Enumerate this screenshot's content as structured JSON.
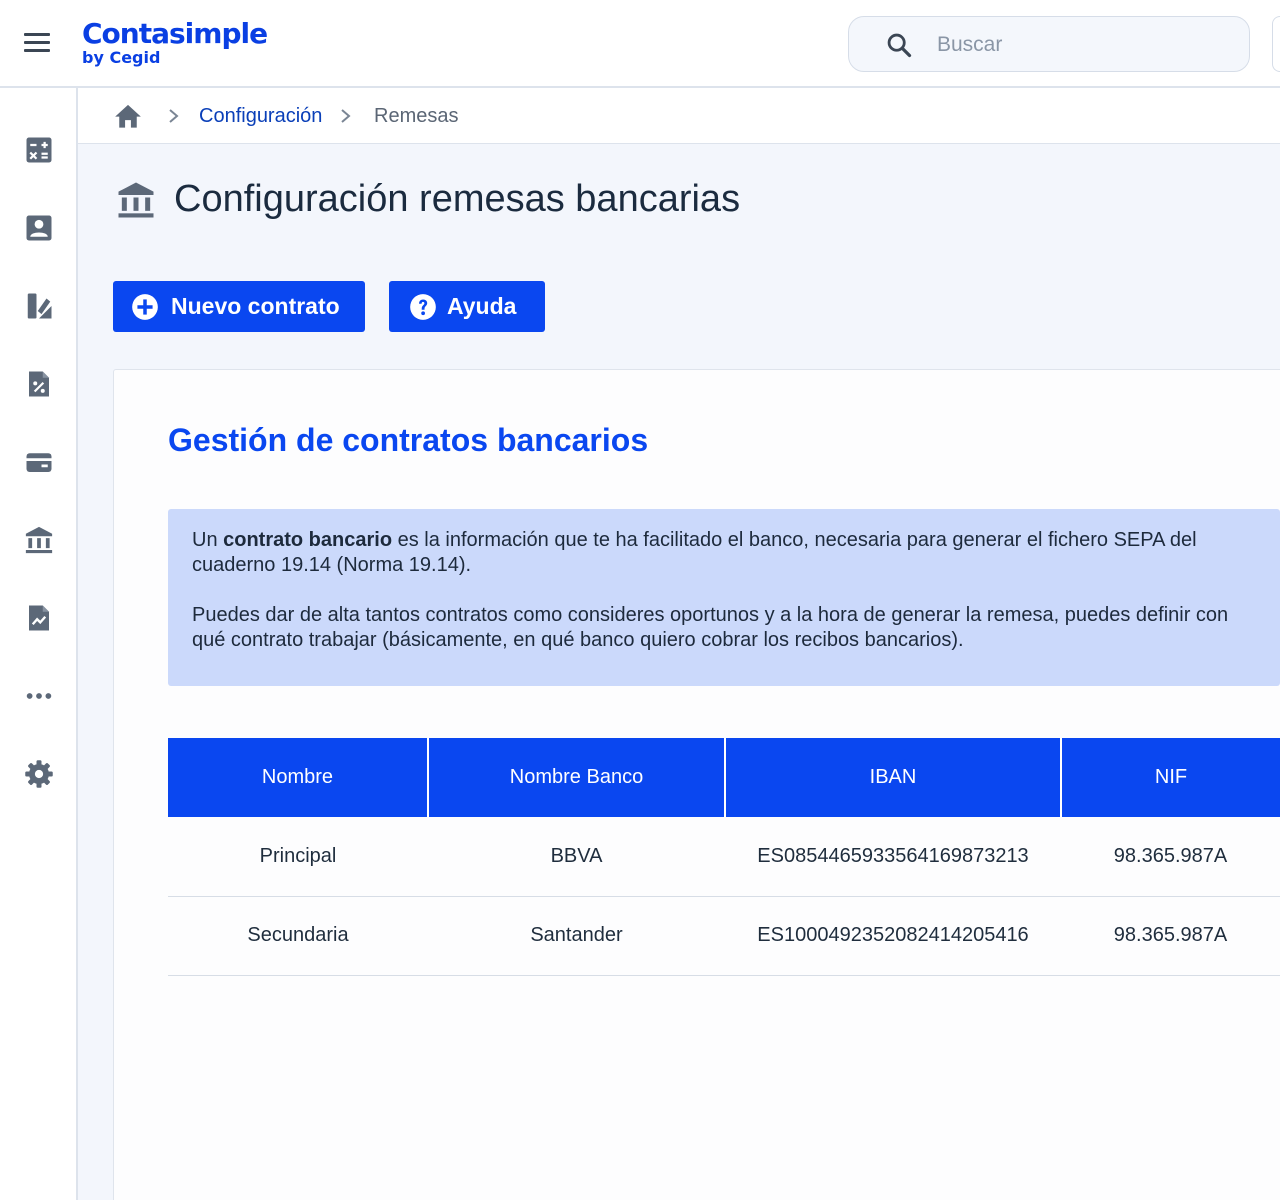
{
  "header": {
    "brand_name": "Contasimple",
    "brand_sub": "by Cegid",
    "search_placeholder": "Buscar"
  },
  "sidebar": {
    "items": [
      {
        "icon": "calculator-icon"
      },
      {
        "icon": "contact-icon"
      },
      {
        "icon": "sales-icon"
      },
      {
        "icon": "tax-document-icon"
      },
      {
        "icon": "wallet-icon"
      },
      {
        "icon": "bank-icon"
      },
      {
        "icon": "report-icon"
      },
      {
        "icon": "more-icon"
      },
      {
        "icon": "settings-icon"
      }
    ]
  },
  "breadcrumb": {
    "home_icon": "home-icon",
    "link": "Configuración",
    "current": "Remesas"
  },
  "page": {
    "title_icon": "bank-icon",
    "title": "Configuración remesas bancarias"
  },
  "actions": {
    "new_contract": "Nuevo contrato",
    "help": "Ayuda"
  },
  "card": {
    "title": "Gestión de contratos bancarios",
    "info": {
      "p1_prefix": "Un ",
      "p1_bold": "contrato bancario",
      "p1_rest": " es la información que te ha facilitado el banco, necesaria para generar el fichero SEPA del cuaderno 19.14 (Norma 19.14).",
      "p2": "Puedes dar de alta tantos contratos como consideres oportunos y a la hora de generar la remesa, puedes definir con qué contrato trabajar (básicamente, en qué banco quiero cobrar los recibos bancarios)."
    },
    "table": {
      "columns": [
        "Nombre",
        "Nombre Banco",
        "IBAN",
        "NIF"
      ],
      "rows": [
        [
          "Principal",
          "BBVA",
          "ES0854465933564169873213",
          "98.365.987A"
        ],
        [
          "Secundaria",
          "Santander",
          "ES1000492352082414205416",
          "98.365.987A"
        ]
      ]
    }
  },
  "colors": {
    "accent": "#0a47f0",
    "brand": "#0a3fe3",
    "info_bg": "#cbd9fb",
    "page_bg": "#f3f6fc"
  }
}
